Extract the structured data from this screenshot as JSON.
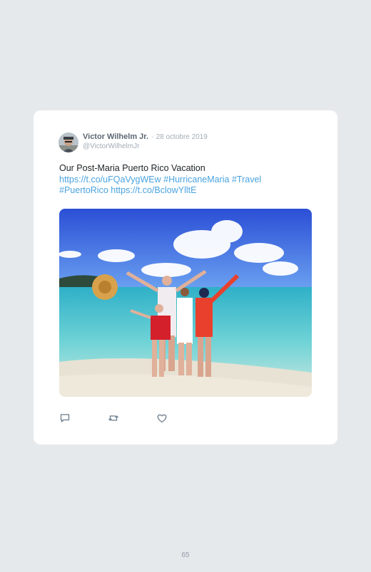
{
  "tweet": {
    "author_name": "Victor Wilhelm Jr.",
    "date": "· 28 octobre 2019",
    "handle": "@VictorWilhelmJr",
    "text_line1": "Our Post-Maria Puerto Rico Vacation",
    "links_line2": "https://t.co/uFQaVygWEw #HurricaneMaria #Travel",
    "links_line3": "#PuertoRico https://t.co/BclowYlltE"
  },
  "actions": {
    "reply_icon": "reply-icon",
    "retweet_icon": "retweet-icon",
    "like_icon": "heart-icon"
  },
  "footer": {
    "page_number": "65"
  },
  "colors": {
    "background": "#e6e9ec",
    "card": "#ffffff",
    "link": "#4aa3df",
    "name": "#5b6672",
    "muted": "#a3acb5"
  }
}
